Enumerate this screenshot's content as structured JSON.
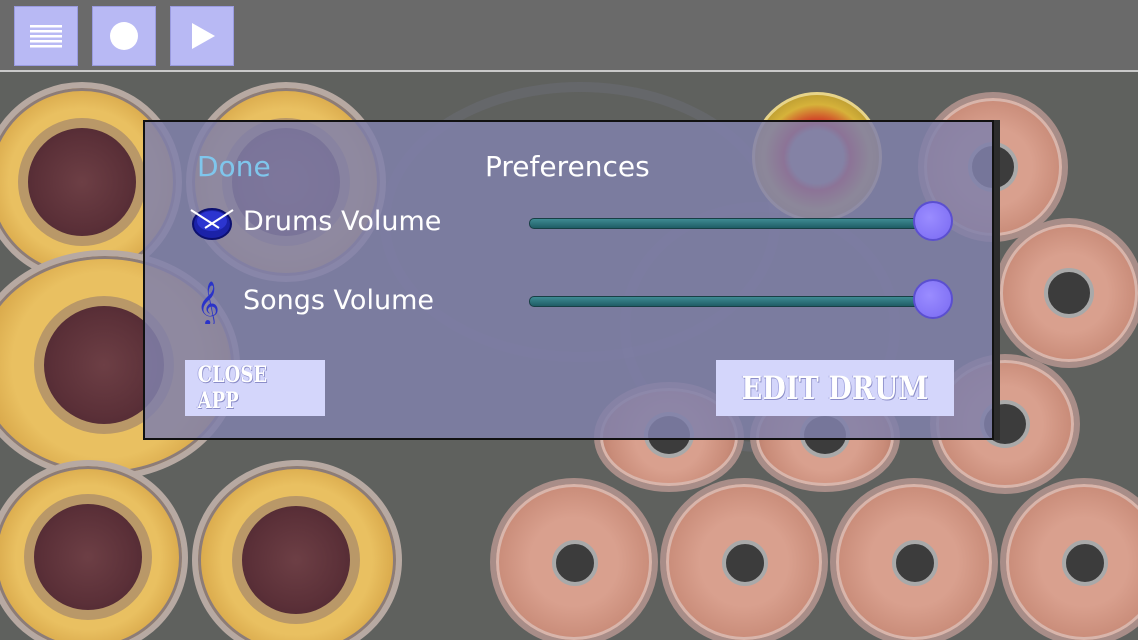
{
  "toolbar": {
    "menu_icon": "list-icon",
    "record_icon": "record-icon",
    "play_icon": "play-icon"
  },
  "dialog": {
    "done_label": "Done",
    "title": "Preferences",
    "drums_volume": {
      "label": "Drums Volume",
      "icon": "drum-icon",
      "value": 1.0
    },
    "songs_volume": {
      "label": "Songs Volume",
      "icon": "treble-clef-icon",
      "value": 1.0
    },
    "close_app_label": "CLOSE APP",
    "edit_drum_label": "EDIT DRUM"
  },
  "colors": {
    "accent_link": "#7fc6ec",
    "dialog_bg": "#8080aa",
    "button_bg": "#d4d6fb",
    "slider_thumb": "#7a6af2"
  }
}
